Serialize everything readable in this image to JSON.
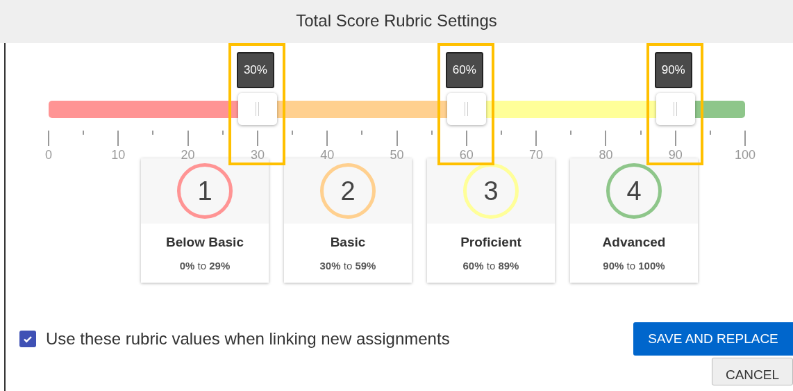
{
  "window": {
    "title": "Total Score Rubric Settings"
  },
  "slider": {
    "segments": [
      {
        "color": "#ff9494"
      },
      {
        "color": "#ffd08f"
      },
      {
        "color": "#ffff99"
      },
      {
        "color": "#8ec68a"
      }
    ],
    "handles": [
      {
        "level": 0.3,
        "label": "30%",
        "highlighted": true
      },
      {
        "level": 0.6,
        "label": "60%",
        "highlighted": true
      },
      {
        "level": 0.9,
        "label": "90%",
        "highlighted": true
      }
    ],
    "ticks": [
      "0",
      "10",
      "20",
      "30",
      "40",
      "50",
      "60",
      "70",
      "80",
      "90",
      "100"
    ]
  },
  "levels": [
    {
      "number": "1",
      "name": "Below Basic",
      "range": "**0%** to **29%**",
      "color": "#ff9494"
    },
    {
      "number": "2",
      "name": "Basic",
      "range": "**30%** to **59%**",
      "color": "#ffd08f"
    },
    {
      "number": "3",
      "name": "Proficient",
      "range": "**60%** to **89%**",
      "color": "#ffff99"
    },
    {
      "number": "4",
      "name": "Advanced",
      "range": "**90%** to **100%**",
      "color": "#8ec68a"
    }
  ],
  "option": {
    "label": "Use these rubric values when linking new assignments",
    "checked": true
  },
  "buttons": [
    {
      "label": "SAVE AND REPLACE",
      "kind": "primary"
    },
    {
      "label": "CANCEL",
      "kind": "secondary"
    }
  ]
}
